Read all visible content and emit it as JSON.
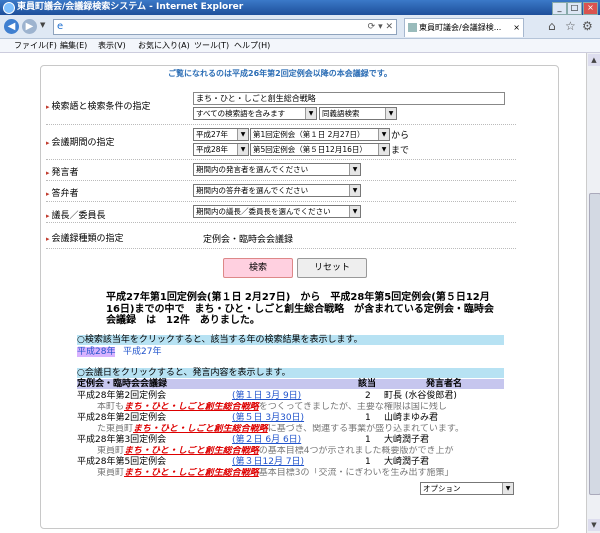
{
  "window": {
    "title": "東員町議会/会議録検索システム - Internet Explorer",
    "controls": [
      "_",
      "□",
      "×"
    ]
  },
  "navbar": {
    "address_value": "",
    "tab_label": "東員町議会/会議録検...",
    "close_tab": "×"
  },
  "menu": [
    "ファイル(F)",
    "編集(E)",
    "表示(V)",
    "お気に入り(A)",
    "ツール(T)",
    "ヘルプ(H)"
  ],
  "form": {
    "notice": "ご覧になれるのは平成26年第2回定例会以降の本会議録です。",
    "labels": {
      "search_condition": "検索語と検索条件の指定",
      "period": "会議期間の指定",
      "speaker": "発言者",
      "answerer": "答弁者",
      "chair": "議長／委員長",
      "type": "会議録種類の指定"
    },
    "keyword_value": "まち・ひと・しごと創生総合戦略",
    "condition_select": "すべての検索語を含みます",
    "synonym_select": "同義語検索",
    "from_year": "平成27年",
    "from_session": "第1回定例会（第１日 2月27日）",
    "from_suffix": "から",
    "to_year": "平成28年",
    "to_session": "第5回定例会（第５日12月16日）",
    "to_suffix": "まで",
    "speaker_select": "期間内の発言者を選んでください",
    "answerer_select": "期間内の答弁者を選んでください",
    "chair_select": "期間内の議長／委員長を選んでください",
    "type_value": "定例会・臨時会会議録",
    "search_button": "検索",
    "reset_button": "リセット"
  },
  "result": {
    "summary": "平成27年第1回定例会(第１日 2月27日)　から　平成28年第5回定例会(第５日12月16日)までの中で　まち・ひと・しごと創生総合戦略　が含まれている定例会・臨時会会議録　は　12件　ありました。",
    "year_header": "○検索該当年をクリックすると、該当する年の検索結果を表示します。",
    "years": [
      "平成28年",
      "平成27年"
    ],
    "day_header": "○会議日をクリックすると、発言内容を表示します。",
    "columns": [
      "定例会・臨時会会議録",
      "該当",
      "発言者名"
    ],
    "rows": [
      {
        "session": "平成28年第2回定例会",
        "date": "(第１日 3月 9日)",
        "count": "2",
        "speaker": "町長 (水谷俊郎君)",
        "snippet_pre": "　本町も",
        "keyword": "まち・ひと・しごと創生総合戦略",
        "snippet_post": "をつくってきましたが、主要な権限は国に残し"
      },
      {
        "session": "平成28年第2回定例会",
        "date": "(第５日 3月30日)",
        "count": "1",
        "speaker": "山崎まゆみ君",
        "snippet_pre": "　た東員町",
        "keyword": "まち・ひと・しごと創生総合戦略",
        "snippet_post": "に基づき、関連する事業が盛り込まれています。"
      },
      {
        "session": "平成28年第3回定例会",
        "date": "(第２日 6月 6日)",
        "count": "1",
        "speaker": "大崎潤子君",
        "snippet_pre": "　東員町",
        "keyword": "まち・ひと・しごと創生総合戦略",
        "snippet_post": "の基本目標4つが示されました概要版ができ上が"
      },
      {
        "session": "平成28年第5回定例会",
        "date": "(第３日12月 7日)",
        "count": "1",
        "speaker": "大崎潤子君",
        "snippet_pre": "　東員町",
        "keyword": "まち・ひと・しごと創生総合戦略",
        "snippet_post": "基本目標3の「交流・にぎわいを生み出す施策」"
      }
    ],
    "option_select": "オプション"
  },
  "colors": {
    "header_bar": "#b7e2f3",
    "table_header": "#c6c6ee",
    "year_highlight": "#d8b2ff",
    "keyword": "#dd0000",
    "notice": "#2b6db5"
  }
}
